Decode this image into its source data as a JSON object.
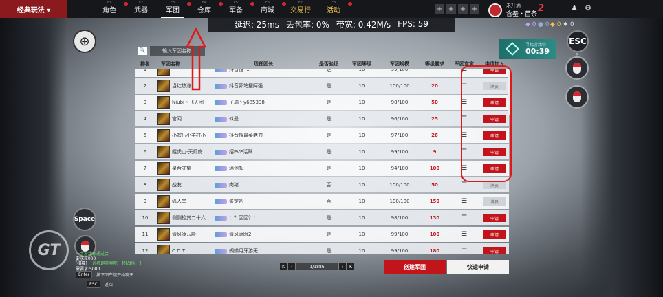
{
  "nav": {
    "mode_label": "经典玩法 ▾",
    "tabs": [
      {
        "label": "角色",
        "key": "F1"
      },
      {
        "label": "武器",
        "key": "F2"
      },
      {
        "label": "军团",
        "key": "F3",
        "sub": "JUNTUAN"
      },
      {
        "label": "仓库",
        "key": "F4"
      },
      {
        "label": "军备",
        "key": "F5"
      },
      {
        "label": "商城",
        "key": "F6"
      },
      {
        "label": "交易行",
        "key": "F7"
      },
      {
        "label": "活动",
        "key": "F8"
      }
    ]
  },
  "net": {
    "latency": "延迟: 25ms",
    "loss": "丢包率: 0%",
    "bandwidth": "带宽: 0.42M/s",
    "fps": "FPS: 59"
  },
  "user": {
    "level": "未升满",
    "name": "含羞・苗条",
    "game_logo": "BATTLE TEAMS",
    "game_logo_num": "2"
  },
  "currency": {
    "c1": "0",
    "c2": "0",
    "c3": "0",
    "c4": "0"
  },
  "match": {
    "label": "寻找游戏中",
    "time": "00:39"
  },
  "esc": {
    "label": "ESC",
    "sub": "X"
  },
  "zoom": {
    "label": "⊕"
  },
  "space": {
    "label": "Space"
  },
  "search": {
    "icon_label": "🔍",
    "placeholder": "输入军团名称"
  },
  "table": {
    "headers": [
      "排名",
      "军团名称",
      "现任团长",
      "是否验证",
      "军团等级",
      "军团规模",
      "等级要求",
      "军团宣言",
      "申请加入"
    ],
    "rows": [
      {
        "rank": "1",
        "name": "",
        "leader": "抖音搜 ...",
        "verified": "是",
        "level": "10",
        "size": "99/100",
        "req": "",
        "apply": "申请"
      },
      {
        "rank": "2",
        "name": "当红热涨",
        "leader": "抖音卵站搜阿强",
        "verified": "是",
        "level": "10",
        "size": "100/100",
        "req": "20",
        "apply": "满员"
      },
      {
        "rank": "3",
        "name": "Niubi丶飞天团",
        "leader": "子瑜丶y685338",
        "verified": "是",
        "level": "10",
        "size": "98/100",
        "req": "50",
        "apply": "申请"
      },
      {
        "rank": "4",
        "name": "官网",
        "leader": "似曼",
        "verified": "是",
        "level": "10",
        "size": "96/100",
        "req": "25",
        "apply": "申请"
      },
      {
        "rank": "5",
        "name": "小欢乐小羊村小",
        "leader": "抖音搜最菜老刀",
        "verified": "是",
        "level": "10",
        "size": "97/100",
        "req": "26",
        "apply": "申请"
      },
      {
        "rank": "6",
        "name": "鲲虎山-天师府",
        "leader": "招PVE活跃",
        "verified": "是",
        "level": "10",
        "size": "99/100",
        "req": "9",
        "apply": "申请"
      },
      {
        "rank": "7",
        "name": "星合守望",
        "leader": "瑶池Tu",
        "verified": "是",
        "level": "10",
        "size": "94/100",
        "req": "100",
        "apply": "申请"
      },
      {
        "rank": "8",
        "name": "战友",
        "leader": "肉猪",
        "verified": "否",
        "level": "10",
        "size": "100/100",
        "req": "50",
        "apply": "满员"
      },
      {
        "rank": "9",
        "name": "狐人堂",
        "leader": "张定初",
        "verified": "否",
        "level": "10",
        "size": "100/100",
        "req": "150",
        "apply": "满员"
      },
      {
        "rank": "10",
        "name": "侧侧检其二十六",
        "leader": "！？区区？！",
        "verified": "是",
        "level": "10",
        "size": "98/100",
        "req": "130",
        "apply": "申请"
      },
      {
        "rank": "11",
        "name": "清风凌云殿",
        "leader": "清风添眼2",
        "verified": "是",
        "level": "10",
        "size": "99/100",
        "req": "100",
        "apply": "申请"
      },
      {
        "rank": "12",
        "name": "C.D.T",
        "leader": "蝴蝶月牙游无",
        "verified": "是",
        "level": "10",
        "size": "99/100",
        "req": "180",
        "apply": "申请"
      }
    ]
  },
  "pager": {
    "page": "1/1886"
  },
  "buttons": {
    "create": "创建军团",
    "quick": "快速申请"
  },
  "chat": {
    "line1": "一手游戏都通过会",
    "line2": "要求:5000",
    "line3_tag": "[招募]",
    "line3": "一起抓跑能量吧一起[战队一]",
    "line4": "需要求:5000",
    "enter_key": "Enter",
    "enter_hint": "按下回车键开始聊天",
    "esc_key": "ESC",
    "esc_hint": "返回"
  },
  "colors": {
    "accent": "#c2151b",
    "mode_bg": "#8b1a1f",
    "annotation": "#e01818"
  }
}
